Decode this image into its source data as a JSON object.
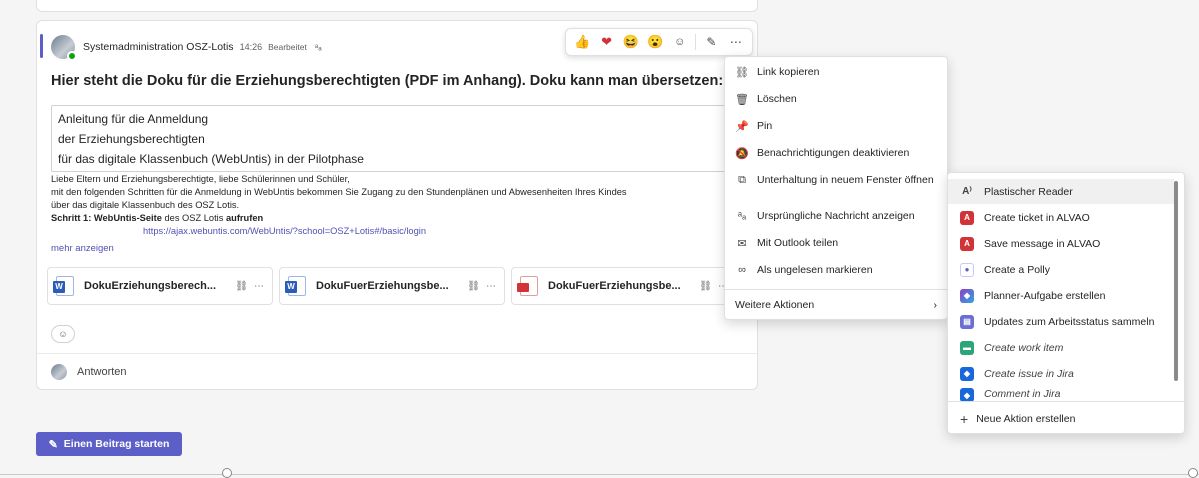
{
  "post": {
    "author": "Systemadministration OSZ-Lotis",
    "time": "14:26",
    "edited": "Bearbeitet",
    "subject": "Hier steht die Doku für die Erziehungsberechtigten (PDF im Anhang). Doku kann man übersetzen:",
    "quote_lines": [
      "Anleitung für die Anmeldung",
      "der Erziehungsberechtigten",
      "für das digitale Klassenbuch (WebUntis) in der Pilotphase"
    ],
    "body_lines": [
      "Liebe Eltern und Erziehungsberechtigte, liebe Schülerinnen und Schüler,",
      "mit den folgenden Schritten für die Anmeldung in WebUntis bekommen Sie Zugang zu den Stundenplänen und Abwesenheiten Ihres Kindes",
      "über das digitale Klassenbuch des OSZ Lotis."
    ],
    "step_label": "Schritt 1:",
    "step_bold1": "WebUntis-Seite",
    "step_mid": " des OSZ Lotis ",
    "step_bold2": "aufrufen",
    "link": "https://ajax.webuntis.com/WebUntis/?school=OSZ+Lotis#/basic/login",
    "more": "mehr anzeigen",
    "attachments": [
      {
        "name": "DokuErziehungsberech...",
        "type": "word"
      },
      {
        "name": "DokuFuerErziehungsbe...",
        "type": "word"
      },
      {
        "name": "DokuFuerErziehungsbe...",
        "type": "pdf"
      }
    ],
    "reply": "Antworten"
  },
  "reactions": [
    "👍",
    "❤",
    "😆",
    "😮"
  ],
  "new_post_label": "Einen Beitrag starten",
  "context_menu": {
    "items": [
      {
        "label": "Link kopieren",
        "icon": "link-icon"
      },
      {
        "label": "Löschen",
        "icon": "trash-icon"
      },
      {
        "label": "Pin",
        "icon": "pin-icon"
      },
      {
        "label": "Benachrichtigungen deaktivieren",
        "icon": "bell-off-icon"
      },
      {
        "label": "Unterhaltung in neuem Fenster öffnen",
        "icon": "open-window-icon"
      },
      {
        "label": "Ursprüngliche Nachricht anzeigen",
        "icon": "translate-icon"
      },
      {
        "label": "Mit Outlook teilen",
        "icon": "mail-icon"
      },
      {
        "label": "Als ungelesen markieren",
        "icon": "glasses-icon"
      }
    ],
    "more_actions": "Weitere Aktionen"
  },
  "submenu": {
    "items": [
      {
        "label": "Plastischer Reader",
        "color": "#5b5fc7"
      },
      {
        "label": "Create ticket in ALVAO",
        "color": "#d13438"
      },
      {
        "label": "Save message in ALVAO",
        "color": "#d13438"
      },
      {
        "label": "Create a Polly",
        "color": "#ffffff"
      },
      {
        "label": "Planner-Aufgabe erstellen",
        "color": "#8b3fc4"
      },
      {
        "label": "Updates zum Arbeitsstatus sammeln",
        "color": "#6b6fd4"
      },
      {
        "label": "Create work item",
        "color": "#2da57a"
      },
      {
        "label": "Create issue in Jira",
        "color": "#1868db"
      },
      {
        "label": "Comment in Jira",
        "color": "#1868db"
      }
    ],
    "new_action": "Neue Aktion erstellen"
  }
}
